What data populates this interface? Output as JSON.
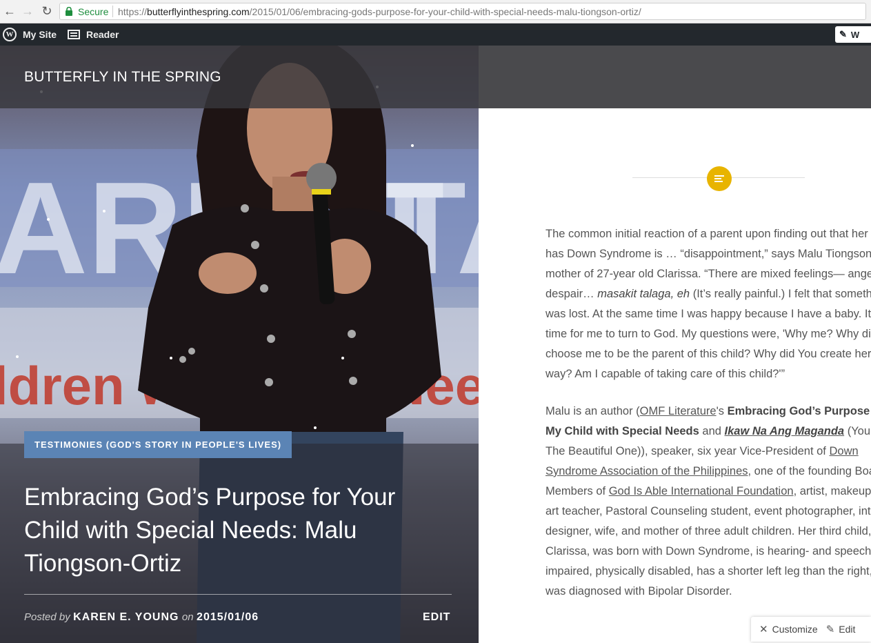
{
  "browser": {
    "secure_label": "Secure",
    "url_scheme": "https://",
    "url_host": "butterflyinthespring.com",
    "url_path": "/2015/01/06/embracing-gods-purpose-for-your-child-with-special-needs-malu-tiongson-ortiz/",
    "icons": {
      "back": "back-arrow-icon",
      "forward": "forward-arrow-icon",
      "reload": "reload-icon",
      "lock": "lock-icon"
    }
  },
  "adminbar": {
    "my_site": "My Site",
    "reader": "Reader",
    "write": "W"
  },
  "site": {
    "title": "BUTTERFLY IN THE SPRING"
  },
  "post": {
    "category": "TESTIMONIES (GOD'S STORY IN PEOPLE'S LIVES)",
    "title": "Embracing God’s Purpose for Your Child with Special Needs: Malu Tiongson-Ortiz",
    "posted_by": "Posted by",
    "author": "KAREN E. YOUNG",
    "on": "on",
    "date": "2015/01/06",
    "edit": "EDIT"
  },
  "content": {
    "p1": {
      "a": "The common initial reaction of a parent upon finding out that her child has Down Syndrome is … “disappointment,” says Malu Tiongson-Ortiz, mother of 27-year old Clarissa. “There are mixed feelings— anger, despair… ",
      "em": "masakit talaga, eh",
      "b": " (It’s really painful.)  I felt that something was lost. At the same time I was happy because I have a baby.  It was a time for me to turn to God.  My questions were, 'Why me? Why did You choose me to be the parent of this child? Why did You create her that way?  Am I capable of taking care of this child?'”"
    },
    "p2": {
      "t1": "Malu is an author (",
      "link1": "OMF Literature",
      "t2": "'s ",
      "bold1": "Embracing God’s Purpose for My Child with Special Needs",
      "t3": " and ",
      "bold2": "Ikaw Na Ang Maganda",
      "t4": " (You are The Beautiful One)), speaker, six year Vice-President of ",
      "link2": "Down Syndrome Association of the Philippines",
      "t5": ", one of the founding Board Members of ",
      "link3": "God Is Able International Foundation",
      "t6": ", artist, makeup artist, art teacher, Pastoral Counseling student,  event photographer, interior designer, wife, and mother of three adult children.  Her third child, Clarissa, was born with Down Syndrome, is hearing- and speech- impaired, physically disabled, has a shorter left leg than the right, and was diagnosed with Bipolar Disorder."
    }
  },
  "customize_bar": {
    "customize": "Customize",
    "edit": "Edit"
  },
  "colors": {
    "accent": "#e8b400",
    "category": "#5b84b5",
    "adminbar": "#23282d"
  }
}
